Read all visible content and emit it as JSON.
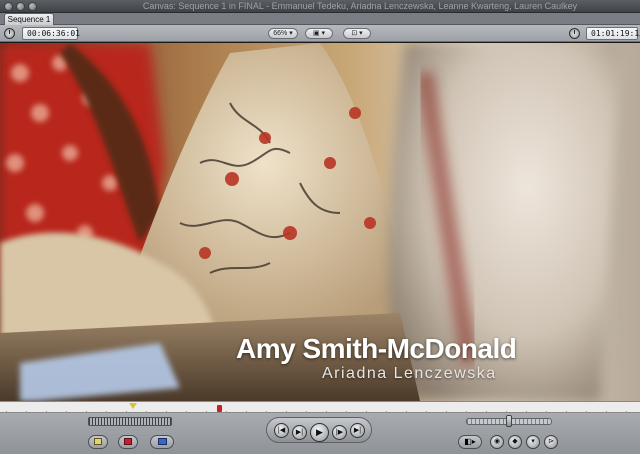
{
  "window": {
    "title": "Canvas: Sequence 1 in FINAL - Emmanuel Tedeku, Ariadna Lenczewska, Leanne Kwarteng, Lauren Caulkey"
  },
  "tabs": [
    {
      "label": "Sequence 1"
    }
  ],
  "toolbar": {
    "timecode_left": "00:06:36:01",
    "zoom": "66%",
    "view_mode_icon": "clip-overlay-icon",
    "view_popup_icon": "frame-view-icon",
    "timecode_right": "01:01:19:13"
  },
  "lower_third": {
    "name": "Amy Smith-McDonald",
    "subtitle": "Ariadna Lenczewska"
  },
  "transport": {
    "buttons": [
      {
        "name": "go-to-previous-edit-icon",
        "glyph": "|◀"
      },
      {
        "name": "play-in-to-out-icon",
        "glyph": "▶|"
      },
      {
        "name": "play-icon",
        "glyph": "▶"
      },
      {
        "name": "play-around-current-icon",
        "glyph": "|▶"
      },
      {
        "name": "go-to-next-edit-icon",
        "glyph": "▶|"
      }
    ]
  },
  "colors": {
    "in_marker": "#cc2020",
    "playhead": "#d6c436",
    "insert_button": "#e2d66a",
    "overwrite_button": "#c8202a",
    "replace_button": "#3b66c7"
  }
}
